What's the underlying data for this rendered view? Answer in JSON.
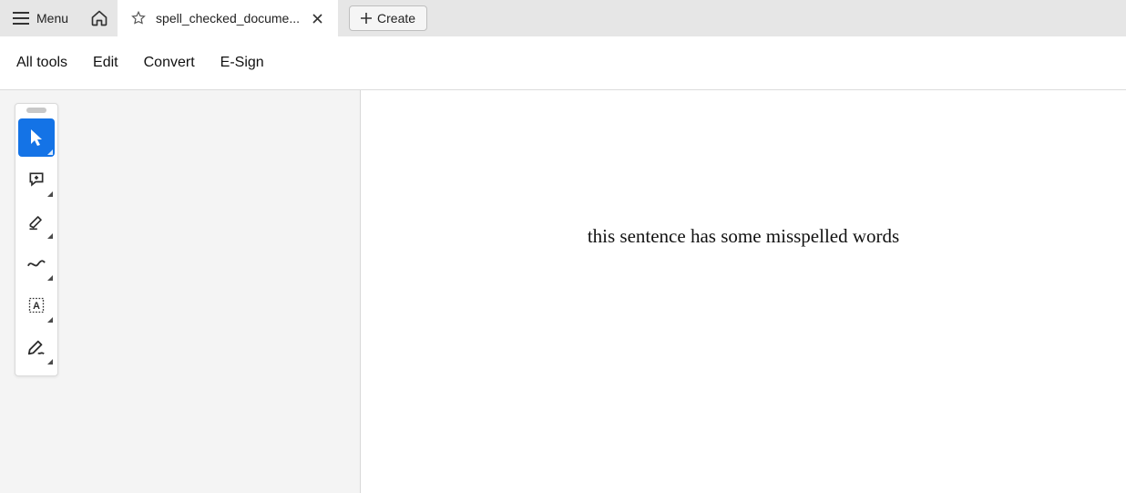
{
  "topbar": {
    "menu_label": "Menu",
    "tab_title": "spell_checked_docume...",
    "create_label": "Create"
  },
  "menubar": {
    "all_tools": "All tools",
    "edit": "Edit",
    "convert": "Convert",
    "esign": "E-Sign"
  },
  "tools": {
    "select": "select-tool",
    "comment": "comment-tool",
    "highlight": "highlight-tool",
    "draw": "draw-tool",
    "textselect": "text-select-tool",
    "sign": "sign-tool"
  },
  "document": {
    "body_text": "this sentence has some misspelled words"
  }
}
